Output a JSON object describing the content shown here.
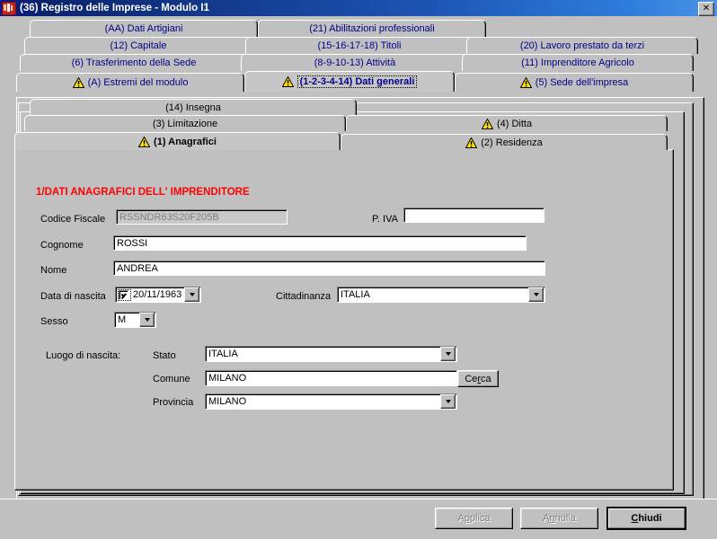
{
  "window": {
    "title": "(36) Registro delle Imprese - Modulo I1",
    "close_label": "✕",
    "icon": "app-icon"
  },
  "outer_tabs": {
    "rows": [
      [
        {
          "label": "(AA) Dati Artigiani",
          "warn": false,
          "active": false
        },
        {
          "label": "(21) Abilitazioni professionali",
          "warn": false,
          "active": false
        }
      ],
      [
        {
          "label": "(12) Capitale",
          "warn": false,
          "active": false
        },
        {
          "label": "(15-16-17-18) Titoli",
          "warn": false,
          "active": false
        },
        {
          "label": "(20) Lavoro prestato da terzi",
          "warn": false,
          "active": false
        }
      ],
      [
        {
          "label": "(6) Trasferimento della Sede",
          "warn": false,
          "active": false
        },
        {
          "label": "(8-9-10-13) Attività",
          "warn": false,
          "active": false
        },
        {
          "label": "(11) Imprenditore Agricolo",
          "warn": false,
          "active": false
        }
      ],
      [
        {
          "label": "(A) Estremi del modulo",
          "warn": true,
          "active": false
        },
        {
          "label": "(1-2-3-4-14) Dati generali",
          "warn": true,
          "active": true
        },
        {
          "label": "(5) Sede dell'impresa",
          "warn": true,
          "active": false
        }
      ]
    ]
  },
  "inner_tabs": {
    "rows": [
      [
        {
          "label": "(14) Insegna",
          "warn": false,
          "active": false
        }
      ],
      [
        {
          "label": "(3) Limitazione",
          "warn": false,
          "active": false
        },
        {
          "label": "(4) Ditta",
          "warn": true,
          "active": false
        }
      ],
      [
        {
          "label": "(1) Anagrafici",
          "warn": true,
          "active": true
        },
        {
          "label": "(2) Residenza",
          "warn": true,
          "active": false
        }
      ]
    ]
  },
  "form": {
    "section_title": "1/DATI ANAGRAFICI DELL' IMPRENDITORE",
    "codice_fiscale": {
      "label": "Codice Fiscale",
      "value": "RSSNDR63S20F205B"
    },
    "piva": {
      "label": "P. IVA",
      "value": ""
    },
    "cognome": {
      "label": "Cognome",
      "value": "ROSSI"
    },
    "nome": {
      "label": "Nome",
      "value": "ANDREA"
    },
    "data_nascita": {
      "label": "Data di nascita",
      "value": "20/11/1963"
    },
    "cittadinanza": {
      "label": "Cittadinanza",
      "value": "ITALIA"
    },
    "sesso": {
      "label": "Sesso",
      "value": "M"
    },
    "luogo_nascita": {
      "label": "Luogo di nascita:"
    },
    "stato": {
      "label": "Stato",
      "value": "ITALIA"
    },
    "comune": {
      "label": "Comune",
      "value": "MILANO"
    },
    "cerca": {
      "pre": "Ce",
      "accel": "r",
      "post": "ca"
    },
    "provincia": {
      "label": "Provincia",
      "value": "MILANO"
    }
  },
  "buttons": {
    "applica": {
      "pre": "A",
      "accel": "p",
      "post": "plica",
      "enabled": false
    },
    "annulla": {
      "pre": "A",
      "accel": "n",
      "post": "nulla",
      "enabled": false
    },
    "chiudi": {
      "pre": "",
      "accel": "C",
      "post": "hiudi",
      "enabled": true
    }
  },
  "colors": {
    "face": "#c0c0c0",
    "title_start": "#0a246a",
    "title_end": "#4a93e8",
    "tab_text": "#00008b",
    "section_red": "#ff0000",
    "warn_yellow": "#ffe400"
  }
}
